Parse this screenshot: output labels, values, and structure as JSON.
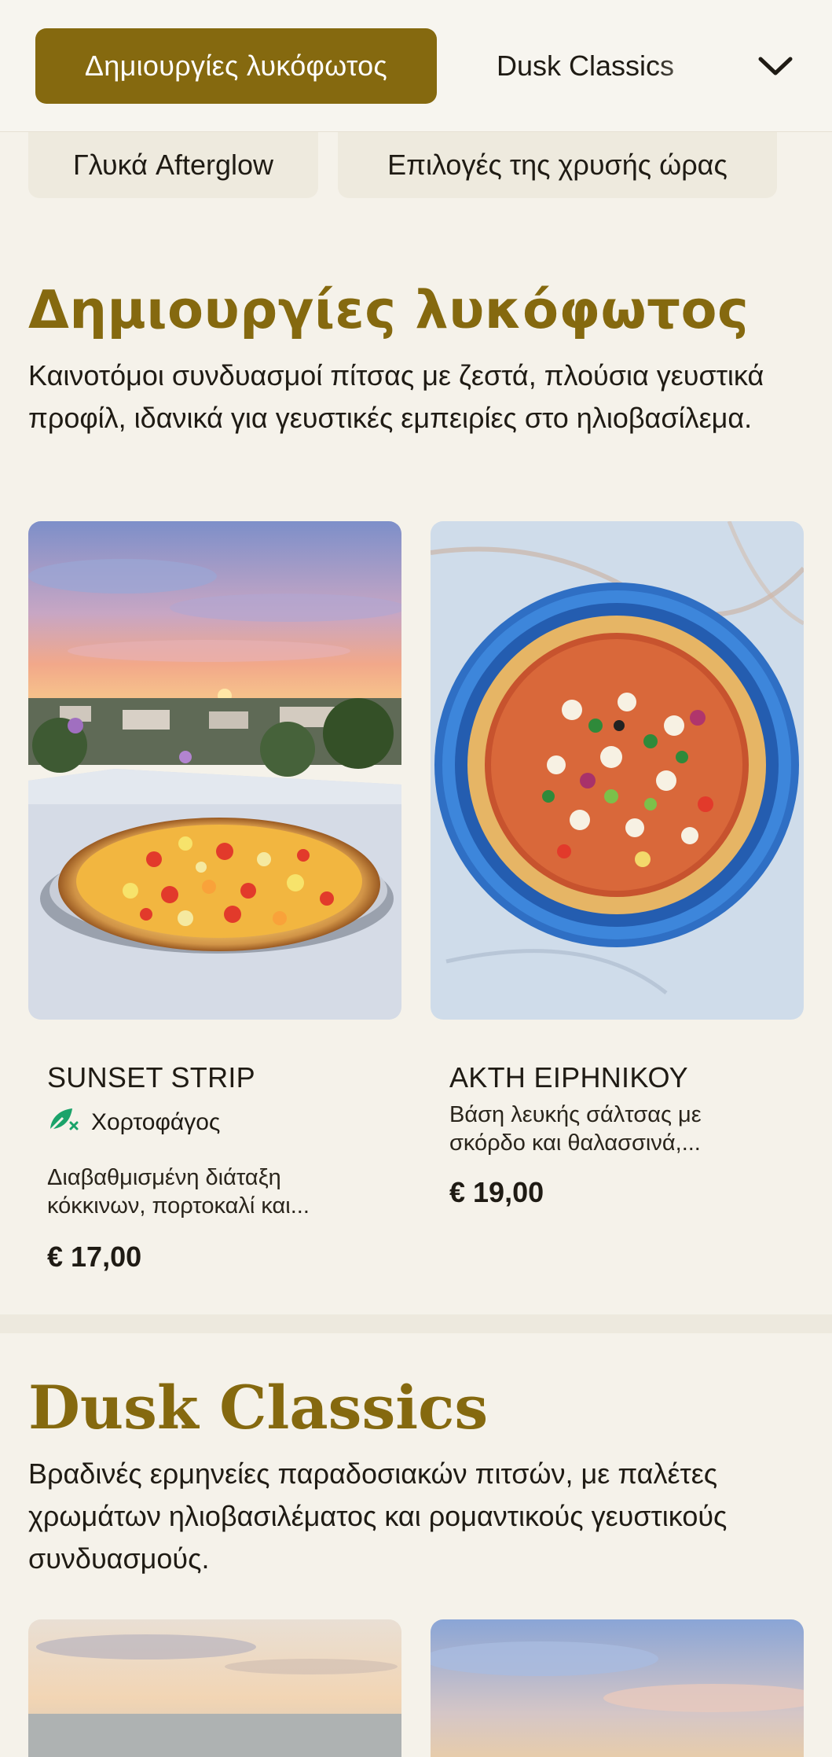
{
  "category_bar": {
    "active_tab": "Δημιουργίες λυκόφωτος",
    "next_tab": "Dusk Classics",
    "chips": [
      "Γλυκά Afterglow",
      "Επιλογές της χρυσής ώρας"
    ]
  },
  "sections": [
    {
      "title": "Δημιουργίες λυκόφωτος",
      "description": "Καινοτόμοι συνδυασμοί πίτσας με ζεστά, πλούσια γευστικά προφίλ, ιδανικά για γευστικές εμπειρίες στο ηλιοβασίλεμα.",
      "items": [
        {
          "name": "SUNSET STRIP",
          "tag": "Χορτοφάγος",
          "description": "Διαβαθμισμένη διάταξη κόκκινων, πορτοκαλί και...",
          "price": "€ 17,00"
        },
        {
          "name": "ΑΚΤΗ ΕΙΡΗΝΙΚΟΥ",
          "description": "Βάση λευκής σάλτσας με σκόρδο και θαλασσινά,...",
          "price": "€ 19,00"
        }
      ]
    },
    {
      "title": "Dusk Classics",
      "description": "Βραδινές ερμηνείες παραδοσιακών πιτσών, με παλέτες χρωμάτων ηλιοβασιλέματος και ρομαντικούς γευστικούς συνδυασμούς."
    }
  ],
  "icons": {
    "expand": "chevron-down-icon",
    "vegetarian": "vegetarian-leaf-icon"
  },
  "colors": {
    "accent": "#85690f",
    "background": "#f5f2ea",
    "vegetarian": "#1aa36a"
  }
}
